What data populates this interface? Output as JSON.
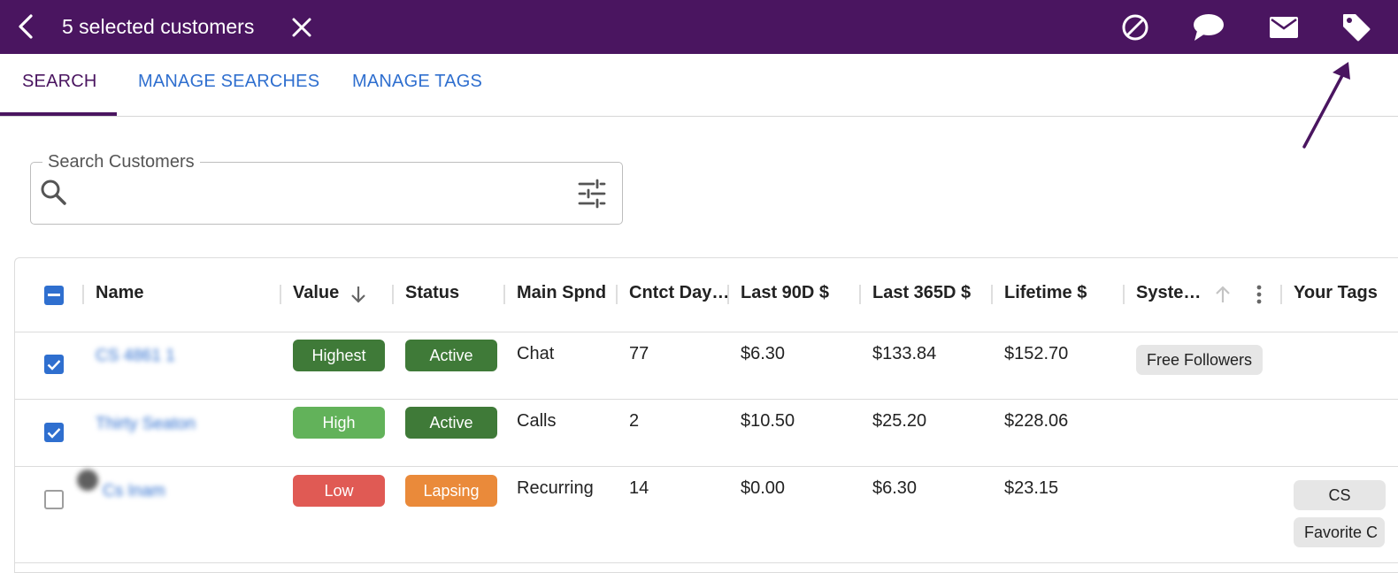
{
  "topbar": {
    "selection_title": "5 selected customers",
    "background": "#4a1560",
    "icons": [
      "back-arrow-icon",
      "close-icon",
      "block-icon",
      "chat-bubble-icon",
      "mail-icon",
      "tag-icon"
    ]
  },
  "tabs": [
    {
      "label": "SEARCH",
      "active": true
    },
    {
      "label": "MANAGE SEARCHES",
      "active": false
    },
    {
      "label": "MANAGE TAGS",
      "active": false
    }
  ],
  "search": {
    "legend": "Search Customers",
    "value": "",
    "placeholder": ""
  },
  "table": {
    "columns": [
      "Name",
      "Value",
      "Status",
      "Main Spnd",
      "Cntct Day…",
      "Last 90D $",
      "Last 365D $",
      "Lifetime $",
      "Syste…",
      "Your Tags"
    ],
    "rows": [
      {
        "selected": true,
        "name": "CS 4861 1",
        "value": "Highest",
        "status": "Active",
        "main_spend": "Chat",
        "contact_days": "77",
        "last_90d": "$6.30",
        "last_365d": "$133.84",
        "lifetime": "$152.70",
        "system_tags": [
          "Free Followers"
        ],
        "your_tags": []
      },
      {
        "selected": true,
        "name": "Thirty Seaton",
        "value": "High",
        "status": "Active",
        "main_spend": "Calls",
        "contact_days": "2",
        "last_90d": "$10.50",
        "last_365d": "$25.20",
        "lifetime": "$228.06",
        "system_tags": [],
        "your_tags": []
      },
      {
        "selected": false,
        "name": "Cs Inam",
        "value": "Low",
        "status": "Lapsing",
        "main_spend": "Recurring",
        "contact_days": "14",
        "last_90d": "$0.00",
        "last_365d": "$6.30",
        "lifetime": "$23.15",
        "system_tags": [],
        "your_tags": [
          "CS",
          "Favorite C"
        ]
      }
    ]
  },
  "colors": {
    "brand_purple": "#4a1560",
    "link_blue": "#2f6fcf",
    "value_highest": "#3f7a38",
    "value_high": "#62b25a",
    "value_low": "#e05a54",
    "status_active": "#3f7a38",
    "status_lapsing": "#ea8a3a"
  }
}
